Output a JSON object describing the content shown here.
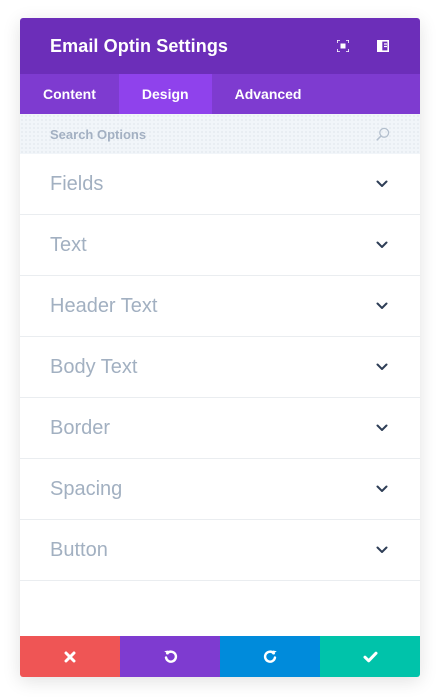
{
  "header": {
    "title": "Email Optin Settings",
    "icons": [
      "expand-icon",
      "sidebar-toggle-icon"
    ]
  },
  "tabs": [
    {
      "label": "Content",
      "active": false
    },
    {
      "label": "Design",
      "active": true
    },
    {
      "label": "Advanced",
      "active": false
    }
  ],
  "search": {
    "placeholder": "Search Options",
    "value": ""
  },
  "sections": [
    {
      "label": "Fields"
    },
    {
      "label": "Text"
    },
    {
      "label": "Header Text"
    },
    {
      "label": "Body Text"
    },
    {
      "label": "Border"
    },
    {
      "label": "Spacing"
    },
    {
      "label": "Button"
    }
  ],
  "footer": {
    "buttons": [
      {
        "icon": "close-icon",
        "color": "#ef5555"
      },
      {
        "icon": "undo-icon",
        "color": "#7e3bd0"
      },
      {
        "icon": "redo-icon",
        "color": "#008bdb"
      },
      {
        "icon": "check-icon",
        "color": "#00c3aa"
      }
    ]
  },
  "colors": {
    "header_bg": "#6c2eb9",
    "tabs_bg": "#7e3bd0",
    "active_tab_bg": "#8f42ec",
    "section_text": "#a2b0c1"
  }
}
